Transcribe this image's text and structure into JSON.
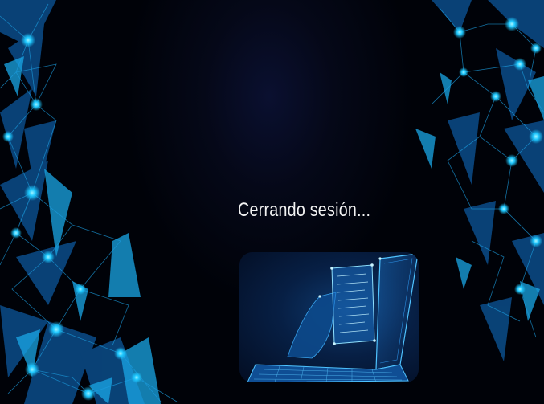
{
  "status": {
    "message": "Cerrando sesión..."
  },
  "illustration": {
    "icon": "laptop-document-icon"
  },
  "colors": {
    "background": "#000208",
    "accent": "#1ec8ff",
    "text": "#f2f2f2"
  }
}
